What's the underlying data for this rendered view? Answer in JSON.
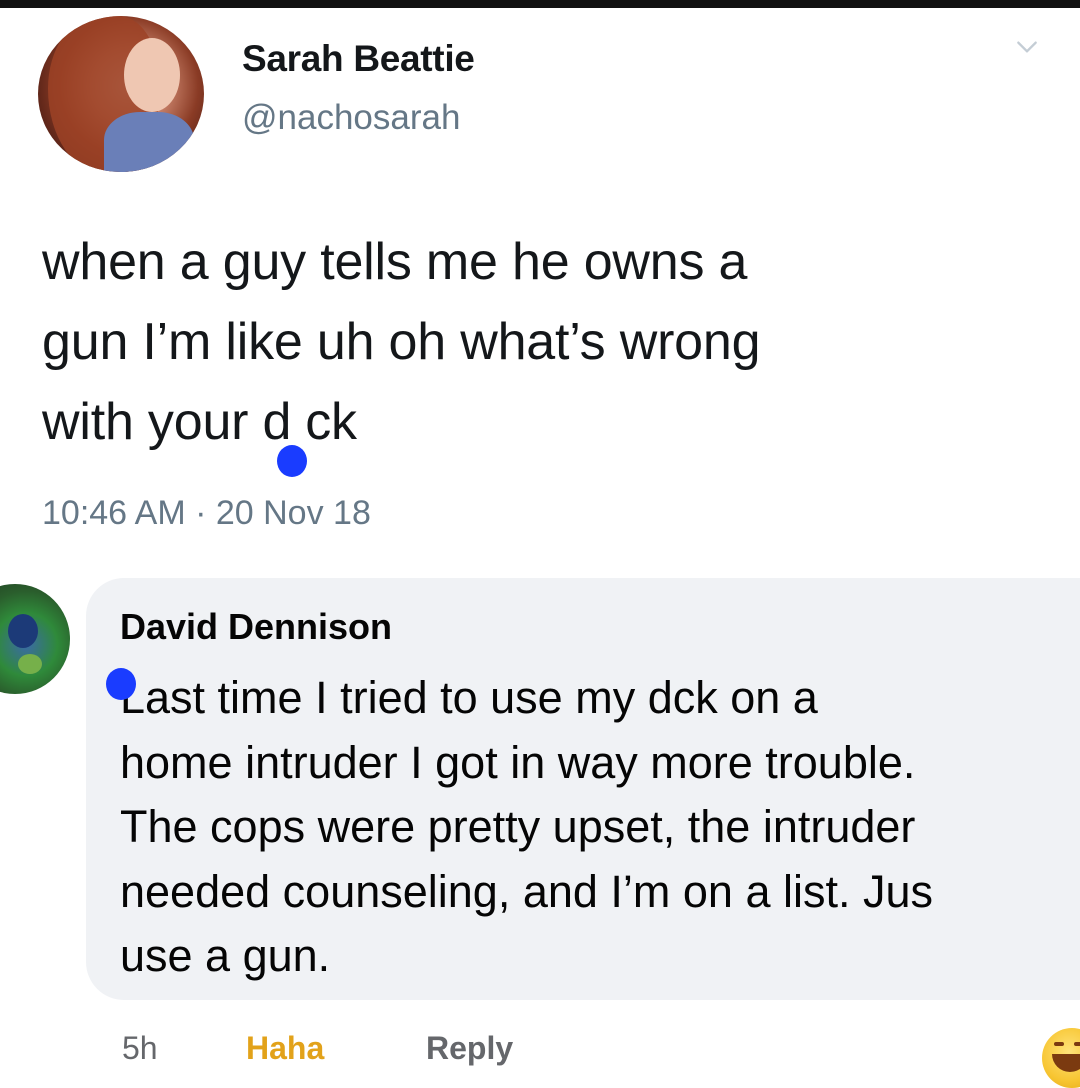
{
  "tweet": {
    "author_name": "Sarah Beattie",
    "author_handle": "@nachosarah",
    "text_lines": [
      "when a guy tells me he owns a",
      "gun I’m like uh oh what’s wrong",
      "with your d",
      "ck"
    ],
    "timestamp": "10:46 AM · 20 Nov 18",
    "icons": {
      "avatar": "profile-photo",
      "menu": "chevron-down-icon",
      "censor_mark": "blue-dot"
    }
  },
  "comment": {
    "author_name": "David Dennison",
    "text_lines": [
      "Last time I tried to use my d",
      "ck on a",
      "home intruder I got in way more trouble.",
      "The cops were pretty upset, the intruder",
      "needed counseling, and I’m on a list. Jus",
      "use a gun."
    ],
    "actions": {
      "time": "5h",
      "haha": "Haha",
      "reply": "Reply"
    },
    "icons": {
      "avatar": "profile-photo-globe",
      "reaction": "haha-emoji-icon"
    }
  },
  "colors": {
    "censor_blue": "#1a3cff",
    "haha_yellow": "#e2a21a",
    "bubble_bg": "#f0f2f5"
  }
}
